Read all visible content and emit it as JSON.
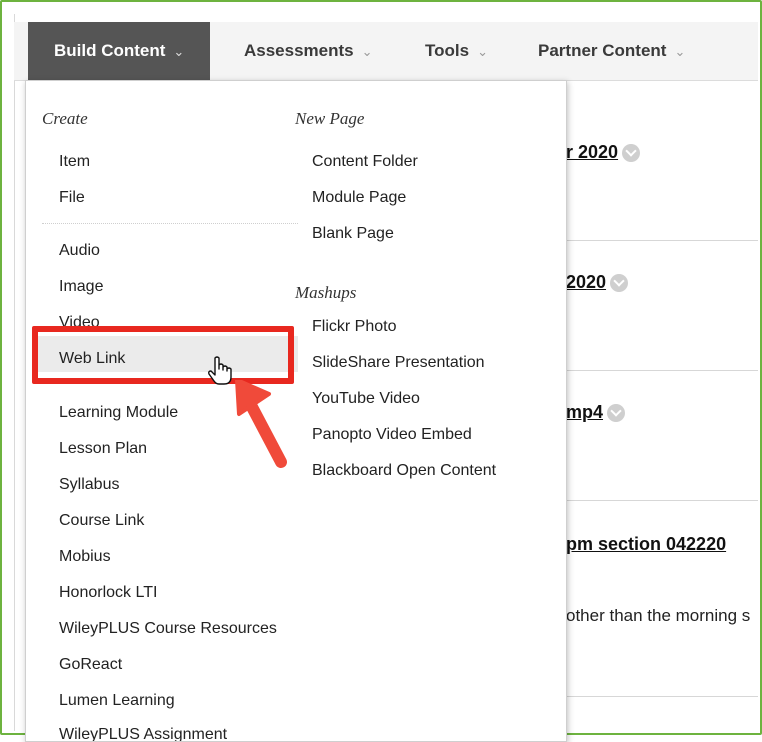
{
  "tabs": {
    "build_content": "Build Content",
    "assessments": "Assessments",
    "tools": "Tools",
    "partner_content": "Partner Content"
  },
  "background_rows": [
    {
      "title": "r 2020"
    },
    {
      "title": "2020"
    },
    {
      "title": "mp4"
    },
    {
      "title": "pm section 042220",
      "desc": "other than the  morning s"
    }
  ],
  "menu": {
    "create": {
      "title": "Create",
      "items": [
        "Item",
        "File",
        "Audio",
        "Image",
        "Video",
        "Web Link",
        "Learning Module",
        "Lesson Plan",
        "Syllabus",
        "Course Link",
        "Mobius",
        "Honorlock LTI",
        "WileyPLUS Course Resources",
        "GoReact",
        "Lumen Learning",
        "WileyPLUS Assignment"
      ]
    },
    "new_page": {
      "title": "New Page",
      "items": [
        "Content Folder",
        "Module Page",
        "Blank Page"
      ]
    },
    "mashups": {
      "title": "Mashups",
      "items": [
        "Flickr Photo",
        "SlideShare Presentation",
        "YouTube Video",
        "Panopto Video Embed",
        "Blackboard Open Content"
      ]
    }
  },
  "colors": {
    "frame": "#6db33f",
    "highlight": "#e8281f",
    "active_tab": "#555555",
    "arrow": "#f04a3a"
  }
}
